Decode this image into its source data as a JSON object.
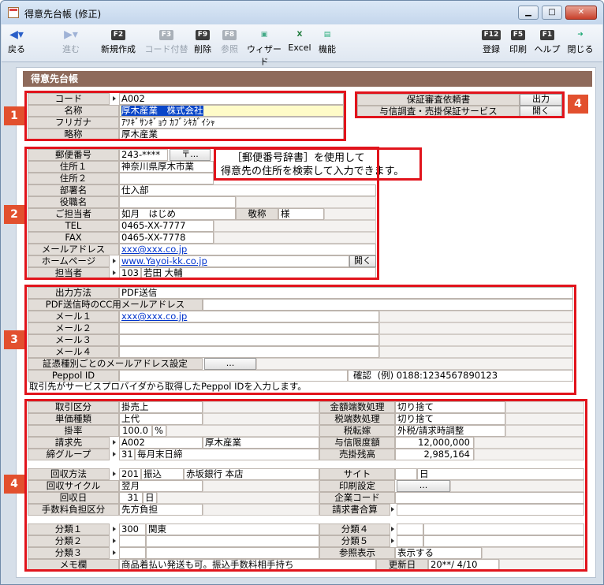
{
  "window": {
    "title": "得意先台帳 (修正)"
  },
  "toolbar": {
    "back": "戻る",
    "forward": "進む",
    "new": {
      "key": "F2",
      "label": "新規作成"
    },
    "code": {
      "key": "F3",
      "label": "コード付替"
    },
    "delete": {
      "key": "F9",
      "label": "削除"
    },
    "ref": {
      "key": "F8",
      "label": "参照"
    },
    "wizard": "ウィザード",
    "excel": "Excel",
    "func": "機能",
    "register": {
      "key": "F12",
      "label": "登録"
    },
    "print": {
      "key": "F5",
      "label": "印刷"
    },
    "help": {
      "key": "F1",
      "label": "ヘルプ"
    },
    "close": "閉じる"
  },
  "header": "得意先台帳",
  "badges": [
    "1",
    "2",
    "3",
    "4",
    "4"
  ],
  "s1": {
    "code_l": "コード",
    "code": "A002",
    "name_l": "名称",
    "name": "厚木産業　株式会社",
    "kana_l": "フリガナ",
    "kana": "ｱﾂｷﾞｻﾝｷﾞｮｳ ｶﾌﾞｼｷｶﾞｲｼｬ",
    "abbr_l": "略称",
    "abbr": "厚木産業"
  },
  "guarantee": {
    "req_l": "保証審査依頼書",
    "req_btn": "出力",
    "svc_l": "与信調査・売掛保証サービス",
    "svc_btn": "開く"
  },
  "s2": {
    "zip_l": "郵便番号",
    "zip": "243-****",
    "zip_btn": "〒...",
    "addr1_l": "住所１",
    "addr1": "神奈川県厚木市業",
    "addr2_l": "住所２",
    "dept_l": "部署名",
    "dept": "仕入部",
    "title_l": "役職名",
    "contact_l": "ご担当者",
    "contact": "如月　はじめ",
    "honor_l": "敬称",
    "honor": "様",
    "tel_l": "TEL",
    "tel": "0465-XX-7777",
    "fax_l": "FAX",
    "fax": "0465-XX-7778",
    "mail_l": "メールアドレス",
    "mail": "xxx@xxx.co.jp",
    "hp_l": "ホームページ",
    "hp": "www.Yayoi-kk.co.jp",
    "hp_btn": "開く",
    "staff_l": "担当者",
    "staff_code": "103",
    "staff": "若田 大輔"
  },
  "callout": {
    "line1": "［郵便番号辞書］を使用して",
    "line2": "得意先の住所を検索して入力できます。"
  },
  "s3": {
    "method_l": "出力方法",
    "method": "PDF送信",
    "cc_l": "PDF送信時のCC用メールアドレス",
    "m1_l": "メール１",
    "m1": "xxx@xxx.co.jp",
    "m2_l": "メール２",
    "m3_l": "メール３",
    "m4_l": "メール４",
    "per_l": "証憑種別ごとのメールアドレス設定",
    "per_btn": "...",
    "peppol_l": "Peppol ID",
    "confirm": "確認",
    "example": "(例) 0188:1234567890123",
    "note": "取引先がサービスプロバイダから取得したPeppol IDを入力します。"
  },
  "s4": {
    "tx_l": "取引区分",
    "tx": "掛売上",
    "price_l": "単価種類",
    "price": "上代",
    "rate_l": "掛率",
    "rate": "100.0",
    "rate_unit": "%",
    "bill_l": "請求先",
    "bill_code": "A002",
    "bill_name": "厚木産業",
    "close_l": "締グループ",
    "close_code": "31",
    "close": "毎月末日締",
    "round_l": "金額端数処理",
    "round": "切り捨て",
    "taxround_l": "税端数処理",
    "taxround": "切り捨て",
    "taxshift_l": "税転嫁",
    "taxshift": "外税/請求時調整",
    "credit_l": "与信限度額",
    "credit": "12,000,000",
    "ar_l": "売掛残高",
    "ar": "2,985,164",
    "collect_l": "回収方法",
    "collect_code": "201",
    "collect": "振込",
    "bank": "赤坂銀行 本店",
    "cycle_l": "回収サイクル",
    "cycle": "翌月",
    "day_l": "回収日",
    "day": "31",
    "day_unit": "日",
    "fee_l": "手数料負担区分",
    "fee": "先方負担",
    "site_l": "サイト",
    "site_unit": "日",
    "print_l": "印刷設定",
    "print_btn": "...",
    "corp_l": "企業コード",
    "sum_l": "請求書合算",
    "c1_l": "分類１",
    "c1_code": "300",
    "c1": "関東",
    "c2_l": "分類２",
    "c3_l": "分類３",
    "c4_l": "分類４",
    "c5_l": "分類５",
    "ref_l": "参照表示",
    "ref": "表示する",
    "memo_l": "メモ欄",
    "memo": "商品着払い発送も可。振込手数料相手持ち",
    "upd_l": "更新日",
    "upd": "20**/ 4/10"
  }
}
